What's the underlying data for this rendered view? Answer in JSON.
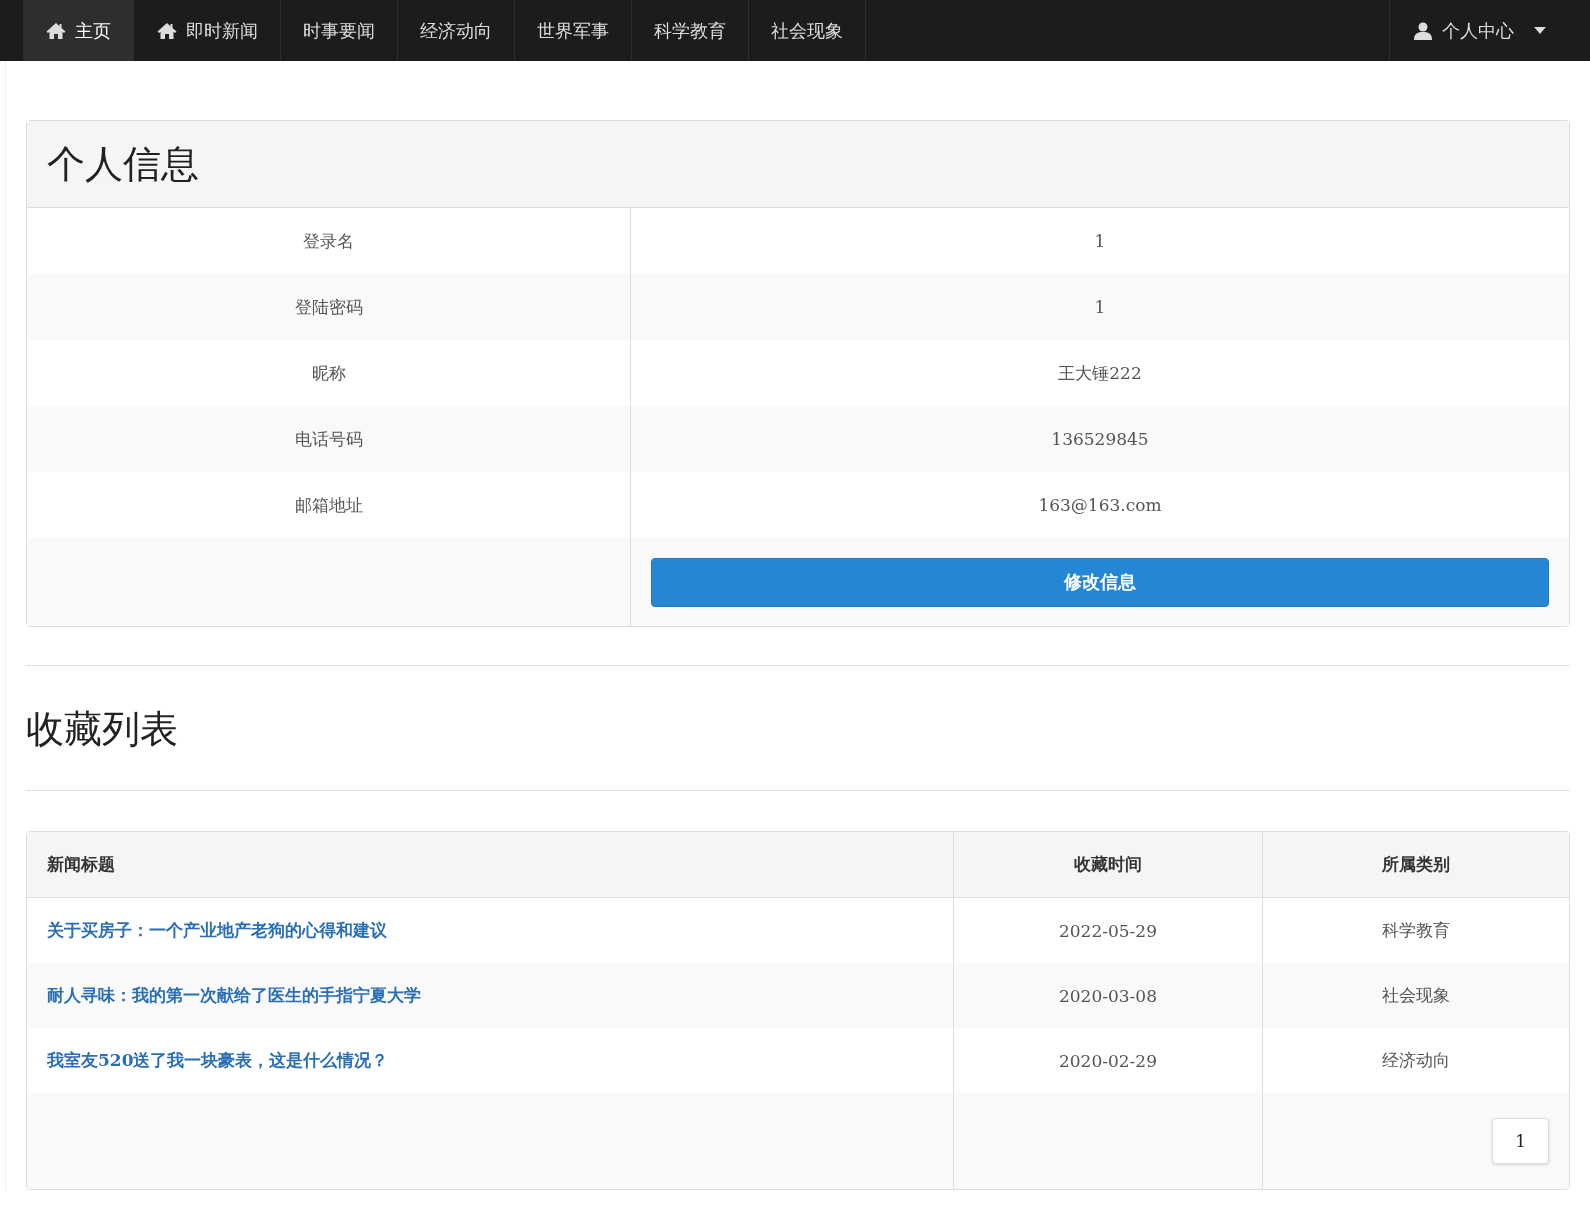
{
  "nav": {
    "items": [
      {
        "label": "主页",
        "kind": "iconlink",
        "selected": true
      },
      {
        "label": "即时新闻",
        "kind": "iconlink",
        "selected": false
      },
      {
        "label": "时事要闻",
        "kind": "textlink",
        "selected": false
      },
      {
        "label": "经济动向",
        "kind": "textlink",
        "selected": false
      },
      {
        "label": "世界军事",
        "kind": "textlink",
        "selected": false
      },
      {
        "label": "科学教育",
        "kind": "textlink",
        "selected": false
      },
      {
        "label": "社会现象",
        "kind": "textlink",
        "selected": false
      }
    ],
    "user_menu": {
      "label": "个人中心"
    }
  },
  "profile": {
    "title": "个人信息",
    "fields": [
      {
        "label": "登录名",
        "value": "1"
      },
      {
        "label": "登陆密码",
        "value": "1"
      },
      {
        "label": "昵称",
        "value": "王大锤222"
      },
      {
        "label": "电话号码",
        "value": "136529845"
      },
      {
        "label": "邮箱地址",
        "value": "163@163.com"
      }
    ],
    "button": "修改信息"
  },
  "favorites": {
    "title": "收藏列表",
    "columns": [
      "新闻标题",
      "收藏时间",
      "所属类别"
    ],
    "rows": [
      {
        "title": "关于买房子：一个产业地产老狗的心得和建议",
        "date": "2022-05-29",
        "category": "科学教育"
      },
      {
        "title": "耐人寻味：我的第一次献给了医生的手指宁夏大学",
        "date": "2020-03-08",
        "category": "社会现象"
      },
      {
        "title": "我室友520送了我一块豪表，这是什么情况？",
        "date": "2020-02-29",
        "category": "经济动向"
      }
    ],
    "pagination": [
      {
        "label": "1"
      }
    ]
  }
}
